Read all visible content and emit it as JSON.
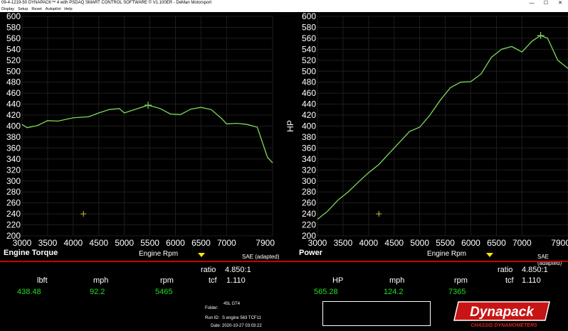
{
  "window": {
    "title": "09-4-1219-50 DYNAPACK™ 4 with PSDAQ SMART CONTROL SOFTWARE © V1.100ER - DeMan Motorsport",
    "controls": [
      "—",
      "☐",
      "✕"
    ]
  },
  "menu": [
    "Display",
    "Setup",
    "Reset",
    "Autopilot",
    "Help"
  ],
  "left_panel": {
    "title": "Engine Torque",
    "x_axis_title": "Engine Rpm",
    "sae": "SAE (adapted)",
    "readout": {
      "ratio_label": "ratio",
      "ratio_value": "4.850:1",
      "col1_label": "lbft",
      "col1_value": "438.48",
      "col2_label": "mph",
      "col2_value": "92.2",
      "col3_label": "rpm",
      "col3_value": "5465",
      "tcf_label": "tcf",
      "tcf_value": "1.110"
    }
  },
  "right_panel": {
    "title": "Power",
    "x_axis_title": "Engine Rpm",
    "sae": "SAE (adapted)",
    "readout": {
      "ratio_label": "ratio",
      "ratio_value": "4.850:1",
      "col1_label": "HP",
      "col1_value": "565.28",
      "col2_label": "mph",
      "col2_value": "124.2",
      "col3_label": "rpm",
      "col3_value": "7365",
      "tcf_label": "tcf",
      "tcf_value": "1.110"
    }
  },
  "info": {
    "folder_label": "Folder:",
    "folder_value": "45L GT4",
    "run_label": "Run ID:",
    "run_value": "S engine 563 TCF11",
    "date_label": "Date:",
    "date_value": "2020-10-27 03:03:22"
  },
  "logo": {
    "main": "Dynapack",
    "sub": "CHASSIS DYNAMOMETERS"
  },
  "colors": {
    "curve": "#7ed957",
    "grid": "#1e1e1e",
    "separator": "#cc0000",
    "value": "#22dd22",
    "arrow": "#ffe600"
  },
  "chart_data": [
    {
      "type": "line",
      "title": "Engine Torque",
      "xlabel": "Engine Rpm",
      "ylabel": "",
      "xlim": [
        3000,
        7900
      ],
      "ylim": [
        200,
        600
      ],
      "xticks": [
        3000,
        3500,
        4000,
        4500,
        5000,
        5500,
        6000,
        6500,
        7000,
        7900
      ],
      "yticks": [
        200,
        220,
        240,
        260,
        280,
        300,
        320,
        340,
        360,
        380,
        400,
        420,
        440,
        460,
        480,
        500,
        520,
        540,
        560,
        580,
        600
      ],
      "series": [
        {
          "x": [
            3000,
            3100,
            3300,
            3500,
            3700,
            4000,
            4300,
            4500,
            4700,
            4900,
            5000,
            5200,
            5465,
            5700,
            5900,
            6100,
            6300,
            6500,
            6700,
            6900,
            7000,
            7200,
            7400,
            7600,
            7800,
            7900
          ],
          "y": [
            403,
            397,
            401,
            410,
            409,
            415,
            417,
            424,
            430,
            432,
            424,
            430,
            438,
            432,
            422,
            421,
            431,
            434,
            430,
            414,
            404,
            405,
            403,
            398,
            343,
            333
          ]
        }
      ],
      "cursor": {
        "x": 5465,
        "y": 438
      },
      "marker": {
        "x": 4200,
        "y": 240
      }
    },
    {
      "type": "line",
      "title": "Power",
      "xlabel": "Engine Rpm",
      "ylabel": "HP",
      "xlim": [
        3000,
        7900
      ],
      "ylim": [
        200,
        600
      ],
      "xticks": [
        3000,
        3500,
        4000,
        4500,
        5000,
        5500,
        6000,
        6500,
        7000,
        7900
      ],
      "yticks": [
        200,
        220,
        240,
        260,
        280,
        300,
        320,
        340,
        360,
        380,
        400,
        420,
        440,
        460,
        480,
        500,
        520,
        540,
        560,
        580,
        600
      ],
      "series": [
        {
          "x": [
            3000,
            3200,
            3400,
            3600,
            3800,
            4000,
            4200,
            4400,
            4600,
            4800,
            5000,
            5200,
            5400,
            5600,
            5800,
            6000,
            6200,
            6400,
            6600,
            6800,
            7000,
            7200,
            7365,
            7500,
            7700,
            7900
          ],
          "y": [
            230,
            245,
            265,
            280,
            298,
            315,
            330,
            350,
            370,
            390,
            398,
            420,
            447,
            470,
            480,
            481,
            495,
            525,
            540,
            545,
            535,
            555,
            565,
            560,
            520,
            505
          ]
        }
      ],
      "cursor": {
        "x": 7365,
        "y": 565
      },
      "marker": {
        "x": 4200,
        "y": 240
      }
    }
  ]
}
